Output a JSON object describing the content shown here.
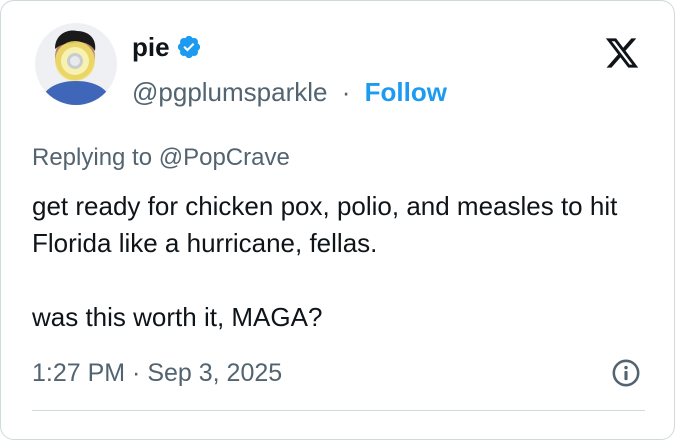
{
  "author": {
    "display_name": "pie",
    "handle": "@pgplumsparkle",
    "separator": "·",
    "follow_label": "Follow",
    "verified": true
  },
  "tweet": {
    "replying_to": "Replying to @PopCrave",
    "paragraph1": "get ready for chicken pox, polio, and measles to hit Florida like a hurricane, fellas.",
    "paragraph2": "was this worth it, MAGA?",
    "timestamp": "1:27 PM · Sep 3, 2025"
  },
  "icons": {
    "verified": "verified-badge-icon",
    "logo": "x-logo-icon",
    "info": "info-icon"
  },
  "colors": {
    "accent": "#1d9bf0",
    "text": "#0f1419",
    "secondary": "#536471",
    "border": "#cfd9de"
  }
}
